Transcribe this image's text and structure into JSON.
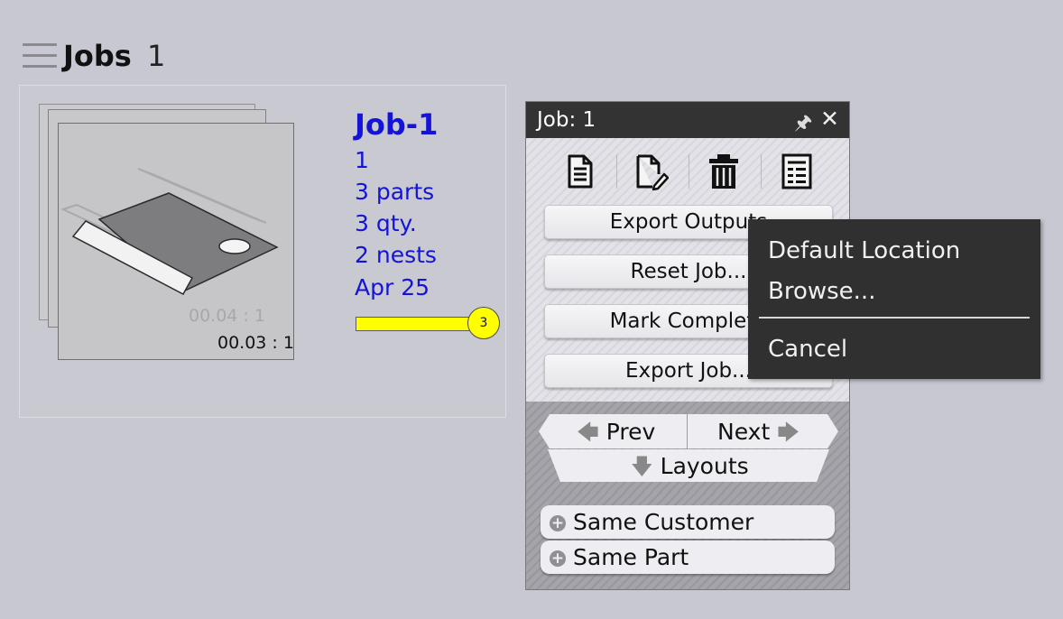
{
  "header": {
    "title": "Jobs",
    "count": "1"
  },
  "job_card": {
    "thumbnail_ghost_ratio": "00.04 : 1",
    "thumbnail_ratio": "00.03 : 1",
    "name": "Job-1",
    "info_lines": [
      "1",
      "3 parts",
      "3 qty.",
      "2 nests",
      "Apr 25"
    ],
    "progress": {
      "badge": "3",
      "fill_color": "#ffff00"
    }
  },
  "job_panel": {
    "title_prefix": "Job:",
    "title_value": "1",
    "toolbar": [
      {
        "icon": "document-icon"
      },
      {
        "icon": "edit-document-icon"
      },
      {
        "icon": "trash-icon"
      },
      {
        "icon": "report-icon"
      }
    ],
    "actions": [
      "Export Outputs",
      "Reset Job...",
      "Mark Complete",
      "Export Job..."
    ],
    "nav": {
      "prev": "Prev",
      "next": "Next",
      "layouts": "Layouts"
    },
    "filters": [
      "Same Customer",
      "Same Part"
    ]
  },
  "context_menu": {
    "items": [
      "Default Location",
      "Browse...",
      "Cancel"
    ]
  },
  "colors": {
    "background": "#c8c8d2",
    "job_link": "#1414d8",
    "panel_header": "#333333",
    "context_menu": "#303030",
    "progress": "#ffff00"
  }
}
